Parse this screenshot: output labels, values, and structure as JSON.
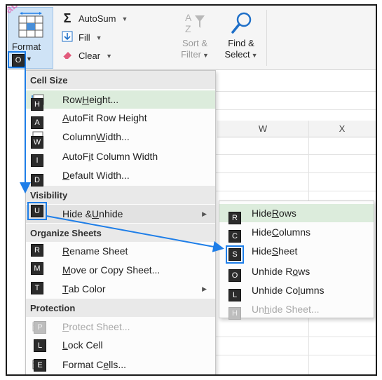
{
  "watermark": {
    "text": "ablebits"
  },
  "ribbon": {
    "format": {
      "label": "Format",
      "keytip": "O"
    },
    "autosum": {
      "label": "AutoSum"
    },
    "fill": {
      "label": "Fill"
    },
    "clear": {
      "label": "Clear"
    },
    "sort_filter": {
      "line1": "Sort &",
      "line2": "Filter"
    },
    "find_select": {
      "line1": "Find &",
      "line2": "Select"
    }
  },
  "grid": {
    "columns": [
      "W",
      "X"
    ]
  },
  "menu": {
    "sections": {
      "cell_size": "Cell Size",
      "visibility": "Visibility",
      "organize": "Organize Sheets",
      "protection": "Protection"
    },
    "items": {
      "row_height": {
        "pre": "Row ",
        "ul": "H",
        "post": "eight...",
        "keytip": "H"
      },
      "autofit_row": {
        "pre": "",
        "ul": "A",
        "post": "utoFit Row Height",
        "keytip": "A"
      },
      "col_width": {
        "pre": "Column ",
        "ul": "W",
        "post": "idth...",
        "keytip": "W"
      },
      "autofit_col": {
        "pre": "AutoF",
        "ul": "i",
        "post": "t Column Width",
        "keytip": "I"
      },
      "default_width": {
        "pre": "",
        "ul": "D",
        "post": "efault Width...",
        "keytip": "D"
      },
      "hide_unhide": {
        "pre": "Hide & ",
        "ul": "U",
        "post": "nhide",
        "keytip": "U"
      },
      "rename": {
        "pre": "",
        "ul": "R",
        "post": "ename Sheet",
        "keytip": "R"
      },
      "move_copy": {
        "pre": "",
        "ul": "M",
        "post": "ove or Copy Sheet...",
        "keytip": "M"
      },
      "tab_color": {
        "pre": "",
        "ul": "T",
        "post": "ab Color",
        "keytip": "T"
      },
      "protect": {
        "pre": "",
        "ul": "P",
        "post": "rotect Sheet...",
        "keytip": "P"
      },
      "lock": {
        "pre": "",
        "ul": "L",
        "post": "ock Cell",
        "keytip": "L"
      },
      "format_cells": {
        "pre": "Format C",
        "ul": "e",
        "post": "lls...",
        "keytip": "E"
      }
    }
  },
  "submenu": {
    "hide_rows": {
      "pre": "Hide ",
      "ul": "R",
      "post": "ows",
      "keytip": "R"
    },
    "hide_cols": {
      "pre": "Hide ",
      "ul": "C",
      "post": "olumns",
      "keytip": "C"
    },
    "hide_sheet": {
      "pre": "Hide ",
      "ul": "S",
      "post": "heet",
      "keytip": "S"
    },
    "unhide_rows": {
      "pre": "Unhide R",
      "ul": "o",
      "post": "ws",
      "keytip": "O"
    },
    "unhide_cols": {
      "pre": "Unhide Co",
      "ul": "l",
      "post": "umns",
      "keytip": "L"
    },
    "unhide_sheet": {
      "pre": "Un",
      "ul": "h",
      "post": "ide Sheet...",
      "keytip": "H"
    }
  },
  "colors": {
    "accent": "#1e7ee8",
    "keytip": "#2b2b2b",
    "highlight": "#dcecdc"
  }
}
